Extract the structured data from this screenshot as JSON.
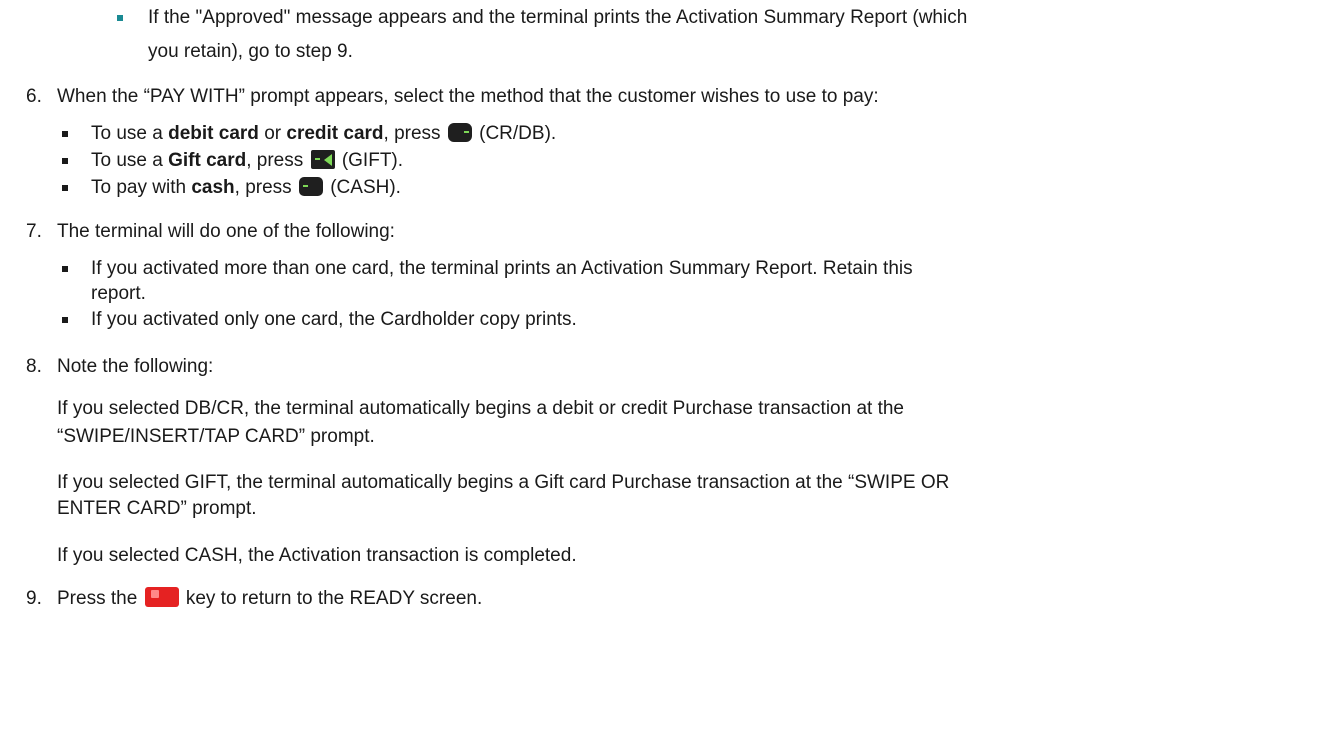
{
  "step5_bullet": {
    "line1": "If the \"Approved\" message appears and the terminal prints the Activation Summary Report (which",
    "line2": "you retain), go to step 9."
  },
  "step6": {
    "number": "6.",
    "text": "When the “PAY WITH” prompt appears, select the method that the customer wishes to use to pay:",
    "bullets": [
      {
        "pre": "To use a ",
        "bold1": "debit card",
        "mid": " or ",
        "bold2": "credit card",
        "press": ", press",
        "after": " (CR/DB).",
        "icon": "crdb-key-icon"
      },
      {
        "pre": "To use a ",
        "bold1": "Gift card",
        "press": ", press",
        "after": " (GIFT).",
        "icon": "gift-key-icon"
      },
      {
        "pre": "To pay with ",
        "bold1": "cash",
        "press": ", press",
        "after": " (CASH).",
        "icon": "cash-key-icon"
      }
    ]
  },
  "step7": {
    "number": "7.",
    "text": "The terminal will do one of the following:",
    "bullets": [
      {
        "line1": "If you activated more than one card, the terminal prints an Activation Summary Report. Retain this",
        "line2": "report."
      },
      {
        "line1": "If you activated only one card, the Cardholder copy prints."
      }
    ]
  },
  "step8": {
    "number": "8.",
    "text": "Note the following:",
    "paragraphs": [
      {
        "line1": "If you selected DB/CR, the terminal automatically begins a debit or credit Purchase transaction at the",
        "line2": "“SWIPE/INSERT/TAP CARD” prompt."
      },
      {
        "line1": "If you selected GIFT, the terminal automatically begins a Gift card Purchase transaction at the “SWIPE OR",
        "line2": "ENTER CARD” prompt."
      },
      {
        "line1": "If you selected CASH, the Activation transaction is completed."
      }
    ]
  },
  "step9": {
    "number": "9.",
    "pre": "Press the",
    "post": " key to return to the READY screen.",
    "icon": "cancel-key-icon"
  },
  "colors": {
    "bullet_teal": "#1a8a93",
    "key_dark": "#1f1f1f",
    "key_green": "#7ed957",
    "cancel_red": "#e52222"
  }
}
